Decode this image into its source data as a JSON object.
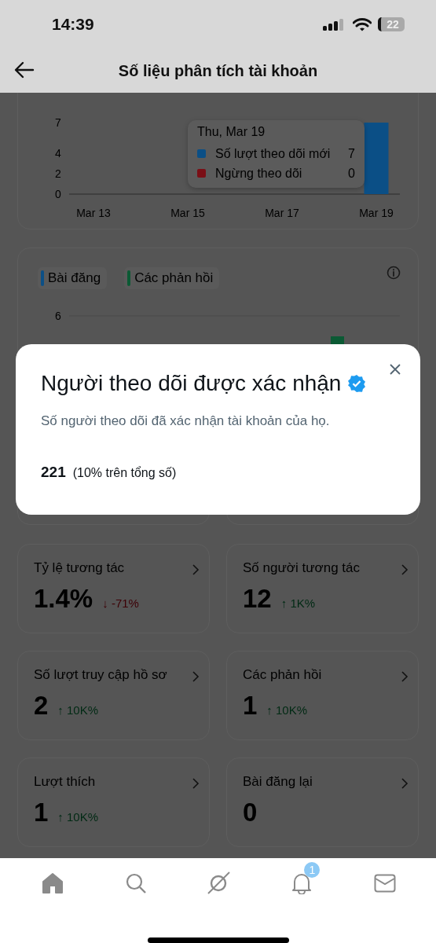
{
  "status_bar": {
    "time": "14:39",
    "battery": "22"
  },
  "header": {
    "title": "Số liệu phân tích tài khoản"
  },
  "followers_chart": {
    "chart_data": {
      "type": "bar",
      "stacked": true,
      "categories": [
        "Mar 13",
        null,
        "Mar 15",
        null,
        "Mar 17",
        null,
        "Mar 19"
      ],
      "series": [
        {
          "color": "#0b4f86",
          "values": [
            0,
            0,
            0,
            0,
            0,
            0,
            7
          ]
        },
        {
          "color": "#7a0f16",
          "values": [
            0,
            0,
            0,
            0,
            0,
            0,
            0
          ]
        }
      ],
      "ylim": [
        0,
        7
      ],
      "yticks": [
        0,
        2,
        4,
        7
      ]
    },
    "tooltip": {
      "date": "Thu, Mar 19",
      "rows": [
        {
          "label": "Số lượt theo dõi mới",
          "value": "7",
          "color": "#0b4f86"
        },
        {
          "label": "Ngừng theo dõi",
          "value": "0",
          "color": "#7a0f16"
        }
      ]
    }
  },
  "posts_chart": {
    "legend": [
      {
        "label": "Bài đăng",
        "color": "#0b4f86"
      },
      {
        "label": "Các phản hồi",
        "color": "#0b5a34"
      }
    ],
    "y_tick": "6"
  },
  "dialog": {
    "title": "Người theo dõi được xác nhận",
    "verified": true,
    "description": "Số người theo dõi đã xác nhận tài khoản của họ.",
    "count": "221",
    "share": "(10% trên tổng số)"
  },
  "stats": [
    {
      "title": "Tỷ lệ tương tác",
      "value": "1.4%",
      "change": "↓ -71%",
      "kind": "down"
    },
    {
      "title": "Số người tương tác",
      "value": "12",
      "change": "↑ 1K%",
      "kind": "up"
    },
    {
      "title": "Số lượt truy cập hồ sơ",
      "value": "2",
      "change": "↑ 10K%",
      "kind": "up"
    },
    {
      "title": "Các phản hồi",
      "value": "1",
      "change": "↑ 10K%",
      "kind": "up"
    },
    {
      "title": "Lượt thích",
      "value": "1",
      "change": "↑ 10K%",
      "kind": "up"
    },
    {
      "title": "Bài đăng lại",
      "value": "0",
      "kind": "none"
    }
  ],
  "nav": [
    {
      "kind": "home",
      "selected": true
    },
    {
      "kind": "search",
      "selected": false
    },
    {
      "kind": "slash",
      "selected": false
    },
    {
      "kind": "bell",
      "selected": false,
      "badge": "1"
    },
    {
      "kind": "mail",
      "selected": false
    }
  ]
}
